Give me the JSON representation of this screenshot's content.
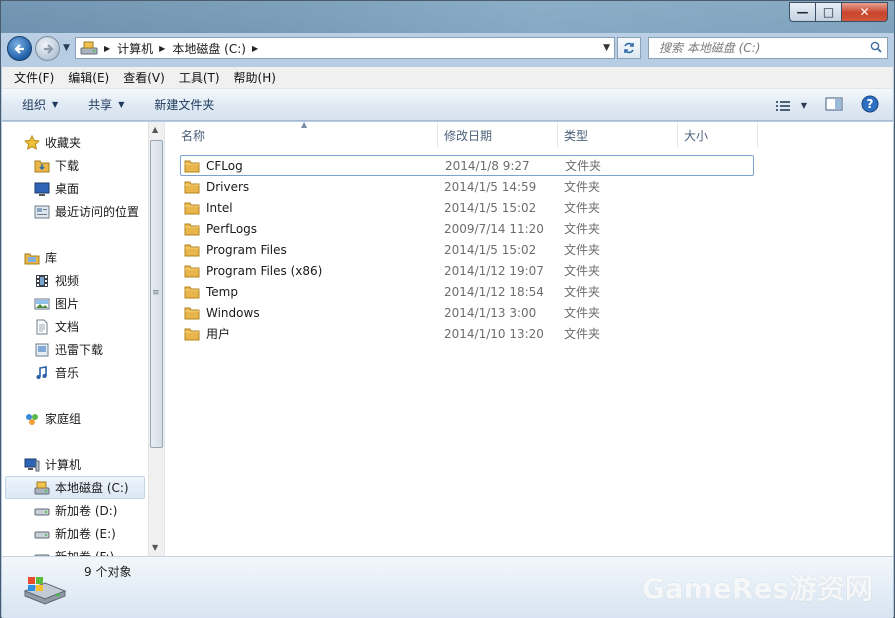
{
  "window": {
    "caption_buttons": {
      "minimize": "—",
      "maximize": "□",
      "close": "✕"
    }
  },
  "address": {
    "crumbs": [
      "计算机",
      "本地磁盘 (C:)"
    ],
    "search_placeholder": "搜索 本地磁盘 (C:)"
  },
  "menu": [
    "文件(F)",
    "编辑(E)",
    "查看(V)",
    "工具(T)",
    "帮助(H)"
  ],
  "commands": {
    "organize": "组织",
    "share": "共享",
    "new_folder": "新建文件夹"
  },
  "nav": {
    "favorites": {
      "label": "收藏夹",
      "items": [
        "下载",
        "桌面",
        "最近访问的位置"
      ]
    },
    "libraries": {
      "label": "库",
      "items": [
        "视频",
        "图片",
        "文档",
        "迅雷下载",
        "音乐"
      ]
    },
    "homegroup": {
      "label": "家庭组"
    },
    "computer": {
      "label": "计算机",
      "items": [
        "本地磁盘 (C:)",
        "新加卷 (D:)",
        "新加卷 (E:)",
        "新加卷 (F:)"
      ]
    }
  },
  "columns": {
    "name": "名称",
    "date": "修改日期",
    "type": "类型",
    "size": "大小"
  },
  "files": [
    {
      "name": "CFLog",
      "date": "2014/1/8 9:27",
      "type": "文件夹"
    },
    {
      "name": "Drivers",
      "date": "2014/1/5 14:59",
      "type": "文件夹"
    },
    {
      "name": "Intel",
      "date": "2014/1/5 15:02",
      "type": "文件夹"
    },
    {
      "name": "PerfLogs",
      "date": "2009/7/14 11:20",
      "type": "文件夹"
    },
    {
      "name": "Program Files",
      "date": "2014/1/5 15:02",
      "type": "文件夹"
    },
    {
      "name": "Program Files (x86)",
      "date": "2014/1/12 19:07",
      "type": "文件夹"
    },
    {
      "name": "Temp",
      "date": "2014/1/12 18:54",
      "type": "文件夹"
    },
    {
      "name": "Windows",
      "date": "2014/1/13 3:00",
      "type": "文件夹"
    },
    {
      "name": "用户",
      "date": "2014/1/10 13:20",
      "type": "文件夹"
    }
  ],
  "status": {
    "count": "9 个对象"
  },
  "watermark": "GameRes游资网",
  "colors": {
    "folder": "#e8b64a",
    "accent": "#1f5fa6",
    "selection_border": "#7da2ce"
  }
}
